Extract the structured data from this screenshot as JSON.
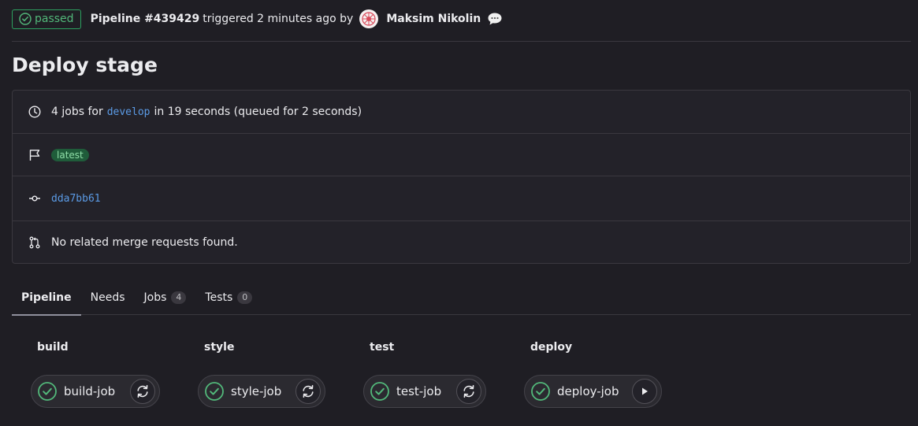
{
  "header": {
    "status_label": "passed",
    "pipeline_label": "Pipeline #439429",
    "triggered_text": "triggered 2 minutes ago by",
    "user_name": "Maksim Nikolin"
  },
  "page_title": "Deploy stage",
  "info": {
    "jobs_prefix": "4 jobs for",
    "branch": "develop",
    "jobs_suffix": "in 19 seconds (queued for 2 seconds)",
    "tag": "latest",
    "commit": "dda7bb61",
    "merge_requests": "No related merge requests found."
  },
  "tabs": [
    {
      "label": "Pipeline"
    },
    {
      "label": "Needs"
    },
    {
      "label": "Jobs",
      "count": "4"
    },
    {
      "label": "Tests",
      "count": "0"
    }
  ],
  "stages": [
    {
      "title": "build",
      "job": "build-job",
      "action_icon": "retry-icon"
    },
    {
      "title": "style",
      "job": "style-job",
      "action_icon": "retry-icon"
    },
    {
      "title": "test",
      "job": "test-job",
      "action_icon": "retry-icon"
    },
    {
      "title": "deploy",
      "job": "deploy-job",
      "action_icon": "play-icon"
    }
  ],
  "colors": {
    "success": "#52b87a",
    "link": "#5b9be6",
    "background": "#1f1e24"
  }
}
